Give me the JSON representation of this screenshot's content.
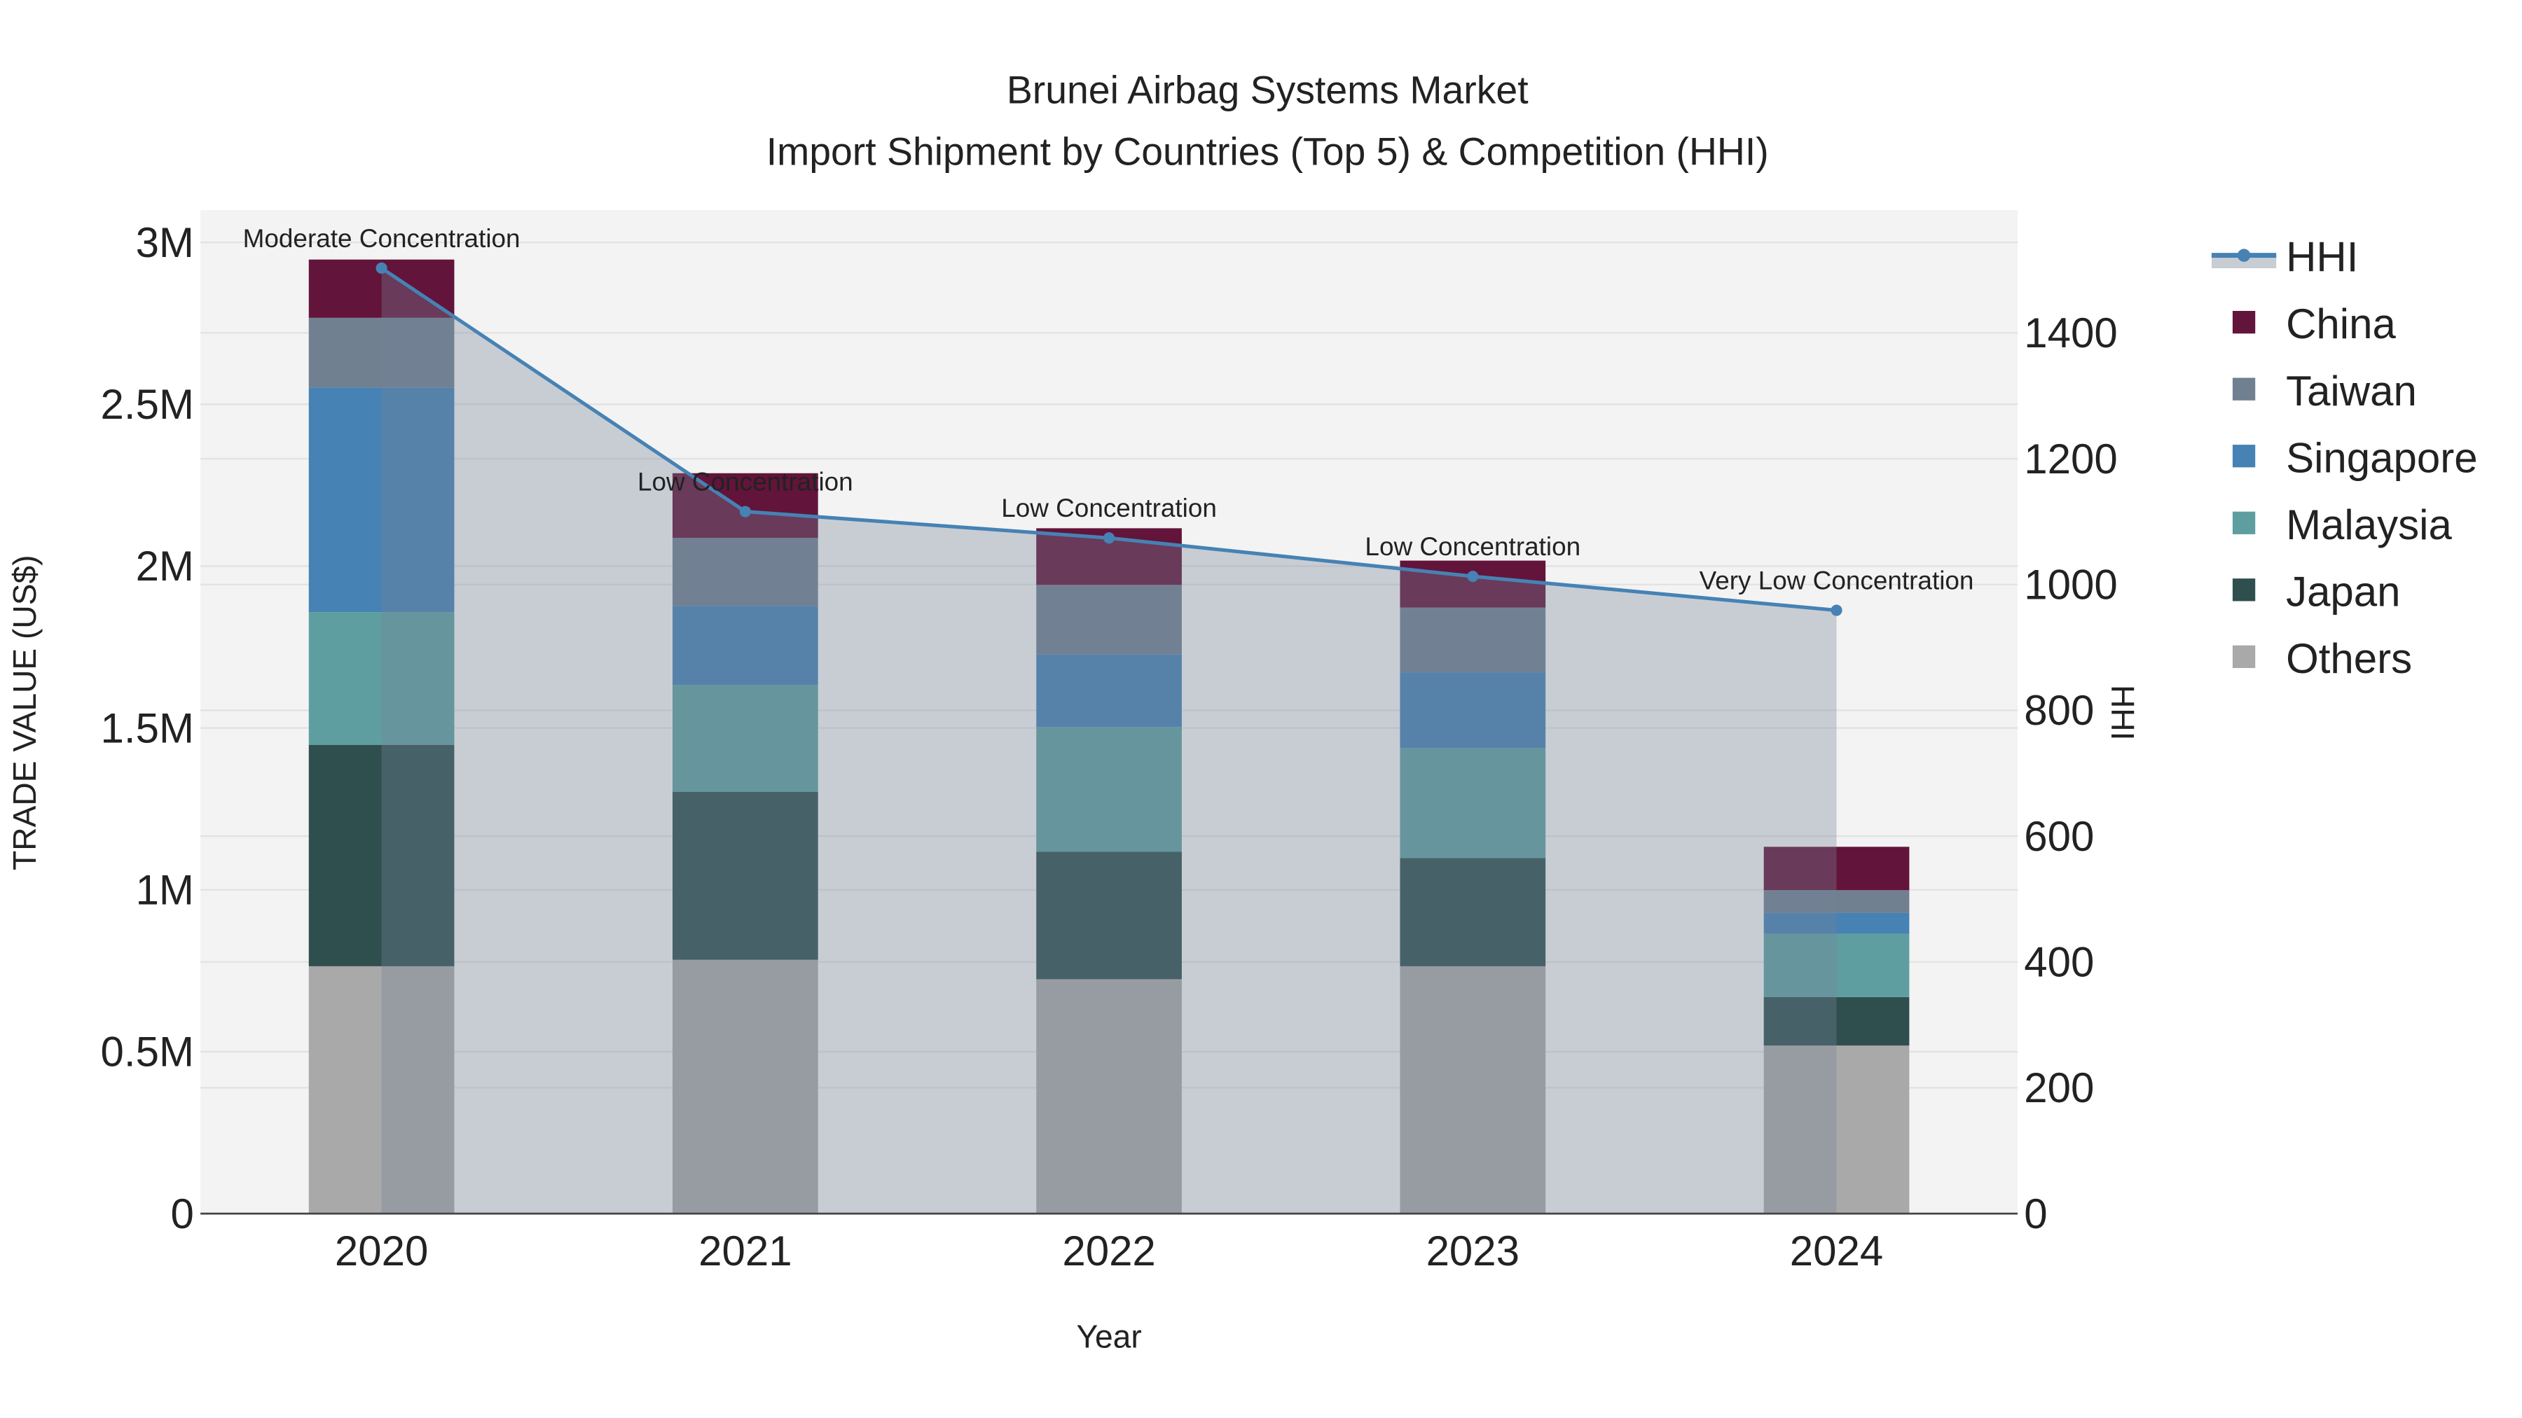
{
  "chart_data": {
    "type": "bar",
    "title": "Brunei Airbag Systems Market",
    "subtitle": "Import Shipment by Countries (Top 5) & Competition (HHI)",
    "xlabel": "Year",
    "ylabel": "TRADE VALUE (US$)",
    "y2label": "HHI",
    "categories": [
      "2020",
      "2021",
      "2022",
      "2023",
      "2024"
    ],
    "ylim": [
      0,
      3000000
    ],
    "y2lim": [
      0,
      1540
    ],
    "yticks": [
      0,
      500000,
      1000000,
      1500000,
      2000000,
      2500000,
      3000000
    ],
    "ytick_labels": [
      "0",
      "0.5M",
      "1M",
      "1.5M",
      "2M",
      "2.5M",
      "3M"
    ],
    "y2ticks": [
      0,
      200,
      400,
      600,
      800,
      1000,
      1200,
      1400
    ],
    "y2tick_labels": [
      "0",
      "200",
      "400",
      "600",
      "800",
      "1000",
      "1200",
      "1400"
    ],
    "grid": true,
    "legend_placement": "right",
    "series": [
      {
        "name": "Others",
        "color": "#a9a9a9",
        "values": [
          764000,
          784000,
          724000,
          764000,
          519000
        ]
      },
      {
        "name": "Japan",
        "color": "#2f4f4f",
        "values": [
          684000,
          519000,
          394000,
          334000,
          150000
        ]
      },
      {
        "name": "Malaysia",
        "color": "#5f9ea0",
        "values": [
          410000,
          330000,
          385000,
          340000,
          195000
        ]
      },
      {
        "name": "Singapore",
        "color": "#4682b4",
        "values": [
          694000,
          244000,
          224000,
          234000,
          65000
        ]
      },
      {
        "name": "Taiwan",
        "color": "#708090",
        "values": [
          215000,
          210000,
          215000,
          200000,
          70000
        ]
      },
      {
        "name": "China",
        "color": "#63143a",
        "values": [
          180000,
          200000,
          175000,
          145000,
          134000
        ]
      }
    ],
    "hhi": {
      "name": "HHI",
      "color": "#4682b4",
      "values": [
        1503,
        1116,
        1074,
        1013,
        959
      ],
      "annotations": [
        "Moderate Concentration",
        "Low Concentration",
        "Low Concentration",
        "Low Concentration",
        "Very Low Concentration"
      ]
    },
    "legend": [
      "HHI",
      "China",
      "Taiwan",
      "Singapore",
      "Malaysia",
      "Japan",
      "Others"
    ]
  }
}
